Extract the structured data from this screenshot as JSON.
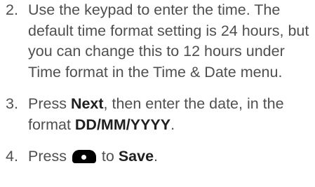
{
  "steps": [
    {
      "number": "2.",
      "text": "Use the keypad to enter the time. The default time format setting is 24 hours, but you can change this to 12 hours under Time format in the Time & Date menu."
    },
    {
      "number": "3.",
      "text_before": "Press ",
      "bold_1": "Next",
      "text_middle": ", then enter the date, in the format ",
      "bold_2": "DD/MM/YYYY",
      "text_after": "."
    },
    {
      "number": "4.",
      "text_before": "Press ",
      "icon": "keypad-key-icon",
      "text_middle": " to ",
      "bold_1": "Save",
      "text_after": "."
    }
  ]
}
